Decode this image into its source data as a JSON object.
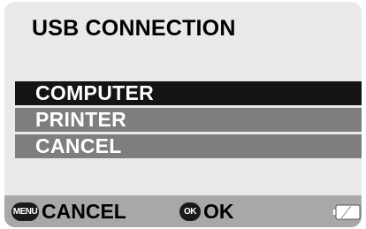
{
  "title": "USB CONNECTION",
  "menu": {
    "items": [
      {
        "label": "COMPUTER",
        "selected": true
      },
      {
        "label": "PRINTER",
        "selected": false
      },
      {
        "label": "CANCEL",
        "selected": false
      }
    ]
  },
  "footer": {
    "menu_icon_label": "MENU",
    "cancel_label": "CANCEL",
    "ok_icon_label": "OK",
    "ok_label": "OK"
  },
  "battery": {
    "icon": "battery-icon"
  },
  "colors": {
    "screen_bg": "#e9e9e9",
    "selected_item_bg": "#141414",
    "item_bg": "#7e7e7e",
    "footer_bg": "#a8a8a8"
  }
}
